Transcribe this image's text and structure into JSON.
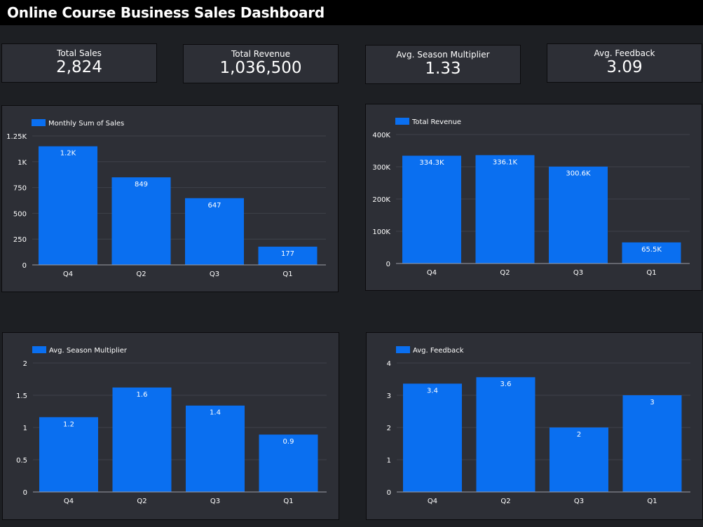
{
  "dashboard": {
    "title": "Online Course Business Sales Dashboard"
  },
  "kpis": [
    {
      "label": "Total Sales",
      "value": "2,824"
    },
    {
      "label": "Total Revenue",
      "value": "1,036,500"
    },
    {
      "label": "Avg. Season Multiplier",
      "value": "1.33"
    },
    {
      "label": "Avg. Feedback",
      "value": "3.09"
    }
  ],
  "colors": {
    "bar": "#0a6ff0",
    "panel": "#2d2f36",
    "grid": "#3f424a",
    "text": "#ffffff",
    "background": "#1d1f23"
  },
  "chart_data": [
    {
      "type": "bar",
      "categories": [
        "Q4",
        "Q2",
        "Q3",
        "Q1"
      ],
      "series": [
        {
          "name": "Monthly Sum of Sales",
          "values": [
            1150,
            849,
            647,
            177
          ]
        }
      ],
      "data_labels": [
        "1.2K",
        "849",
        "647",
        "177"
      ],
      "yticks": [
        0,
        250,
        500,
        750,
        1000,
        1250
      ],
      "ytick_labels": [
        "0",
        "250",
        "500",
        "750",
        "1K",
        "1.25K"
      ],
      "ylim": [
        0,
        1250
      ],
      "legend": "top-left",
      "grid": true
    },
    {
      "type": "bar",
      "categories": [
        "Q4",
        "Q2",
        "Q3",
        "Q1"
      ],
      "series": [
        {
          "name": "Total Revenue",
          "values": [
            334300,
            336100,
            300600,
            65500
          ]
        }
      ],
      "data_labels": [
        "334.3K",
        "336.1K",
        "300.6K",
        "65.5K"
      ],
      "yticks": [
        0,
        100000,
        200000,
        300000,
        400000
      ],
      "ytick_labels": [
        "0",
        "100K",
        "200K",
        "300K",
        "400K"
      ],
      "ylim": [
        0,
        400000
      ],
      "legend": "top-left",
      "grid": true
    },
    {
      "type": "bar",
      "categories": [
        "Q4",
        "Q2",
        "Q3",
        "Q1"
      ],
      "series": [
        {
          "name": "Avg. Season Multiplier",
          "values": [
            1.16,
            1.62,
            1.34,
            0.89
          ]
        }
      ],
      "data_labels": [
        "1.2",
        "1.6",
        "1.4",
        "0.9"
      ],
      "yticks": [
        0,
        0.5,
        1,
        1.5,
        2
      ],
      "ytick_labels": [
        "0",
        "0.5",
        "1",
        "1.5",
        "2"
      ],
      "ylim": [
        0,
        2
      ],
      "legend": "top-left",
      "grid": true
    },
    {
      "type": "bar",
      "categories": [
        "Q4",
        "Q2",
        "Q3",
        "Q1"
      ],
      "series": [
        {
          "name": "Avg. Feedback",
          "values": [
            3.36,
            3.56,
            2.0,
            3.0
          ]
        }
      ],
      "data_labels": [
        "3.4",
        "3.6",
        "2",
        "3"
      ],
      "yticks": [
        0,
        1,
        2,
        3,
        4
      ],
      "ytick_labels": [
        "0",
        "1",
        "2",
        "3",
        "4"
      ],
      "ylim": [
        0,
        4
      ],
      "legend": "top-left",
      "grid": true
    }
  ]
}
